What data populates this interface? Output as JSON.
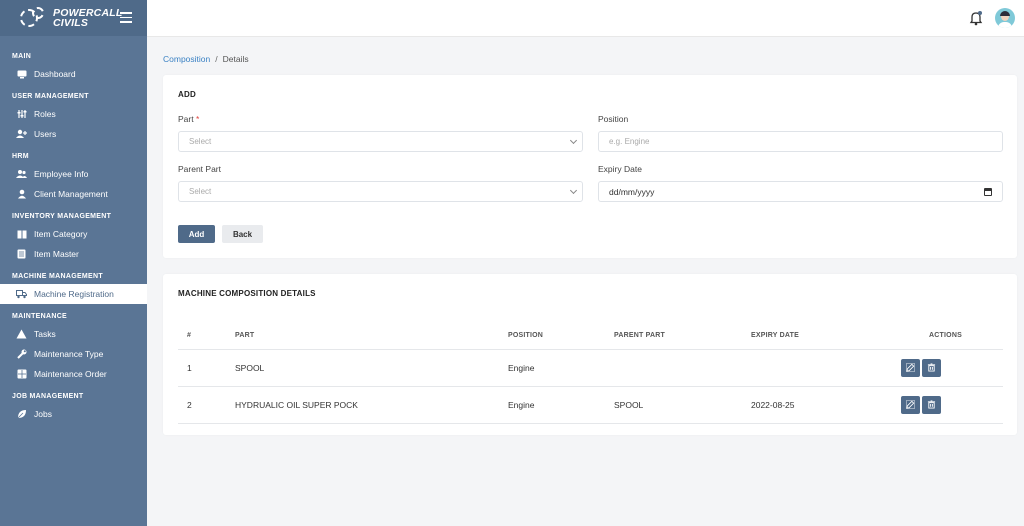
{
  "brand": {
    "line1": "POWERCALL",
    "line2": "CIVILS"
  },
  "sidebar": {
    "sections": [
      {
        "title": "MAIN",
        "items": [
          {
            "label": "Dashboard",
            "icon": "monitor-icon"
          }
        ]
      },
      {
        "title": "USER MANAGEMENT",
        "items": [
          {
            "label": "Roles",
            "icon": "sliders-icon"
          },
          {
            "label": "Users",
            "icon": "user-plus-icon"
          }
        ]
      },
      {
        "title": "HRM",
        "items": [
          {
            "label": "Employee Info",
            "icon": "users-icon"
          },
          {
            "label": "Client Management",
            "icon": "user-icon"
          }
        ]
      },
      {
        "title": "INVENTORY MANAGEMENT",
        "items": [
          {
            "label": "Item Category",
            "icon": "book-icon"
          },
          {
            "label": "Item Master",
            "icon": "file-icon"
          }
        ]
      },
      {
        "title": "MACHINE MANAGEMENT",
        "items": [
          {
            "label": "Machine Registration",
            "icon": "truck-icon",
            "active": true
          }
        ]
      },
      {
        "title": "MAINTENANCE",
        "items": [
          {
            "label": "Tasks",
            "icon": "warning-icon"
          },
          {
            "label": "Maintenance Type",
            "icon": "wrench-icon"
          },
          {
            "label": "Maintenance Order",
            "icon": "grid-icon"
          }
        ]
      },
      {
        "title": "JOB MANAGEMENT",
        "items": [
          {
            "label": "Jobs",
            "icon": "leaf-icon"
          }
        ]
      }
    ]
  },
  "breadcrumb": {
    "link": "Composition",
    "separator": "/",
    "current": "Details"
  },
  "add_form": {
    "title": "ADD",
    "part_label": "Part",
    "required_mark": "*",
    "part_placeholder": "Select",
    "position_label": "Position",
    "position_placeholder": "e.g. Engine",
    "parent_part_label": "Parent Part",
    "parent_part_placeholder": "Select",
    "expiry_label": "Expiry Date",
    "expiry_placeholder": "dd/mm/yyyy",
    "add_button": "Add",
    "back_button": "Back"
  },
  "details": {
    "title": "MACHINE COMPOSITION DETAILS",
    "columns": [
      "#",
      "PART",
      "POSITION",
      "PARENT PART",
      "EXPIRY DATE",
      "ACTIONS"
    ],
    "rows": [
      {
        "num": "1",
        "part": "SPOOL",
        "position": "Engine",
        "parent_part": "",
        "expiry_date": ""
      },
      {
        "num": "2",
        "part": "HYDRUALIC OIL SUPER POCK",
        "position": "Engine",
        "parent_part": "SPOOL",
        "expiry_date": "2022-08-25"
      }
    ]
  },
  "colors": {
    "sidebar": "#5a7595",
    "primary": "#4f6a89",
    "link": "#3b82c4",
    "required": "#e0443e"
  }
}
